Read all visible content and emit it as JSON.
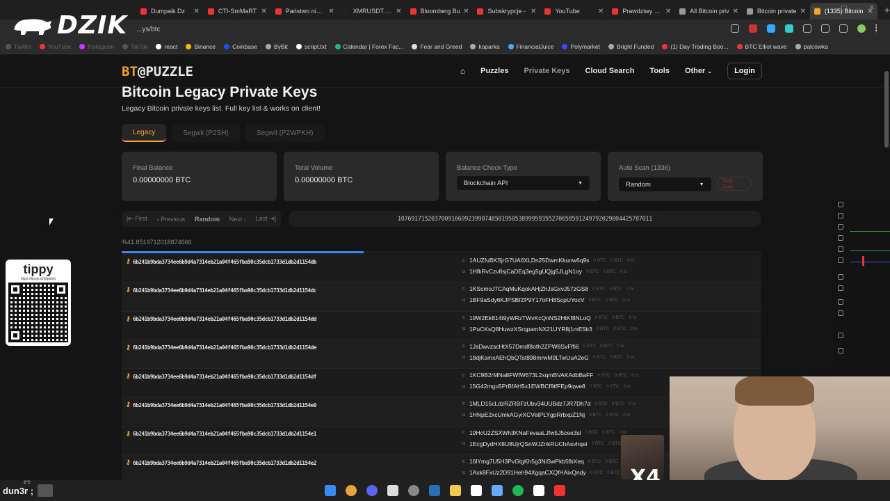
{
  "overlay": {
    "brand": "DZIK"
  },
  "browser": {
    "tabs": [
      {
        "label": "Dumpaik Dz",
        "color": "#e33"
      },
      {
        "label": "CTI-SmMaRT",
        "color": "#e33"
      },
      {
        "label": "Państwo nieuz",
        "color": "#e33"
      },
      {
        "label": "XMRUSDT.P 4",
        "color": "#222"
      },
      {
        "label": "Bloomberg Bu",
        "color": "#e33"
      },
      {
        "label": "Subskrypcje -",
        "color": "#e33"
      },
      {
        "label": "YouTube",
        "color": "#e33"
      },
      {
        "label": "Prawdziwy Lon",
        "color": "#e33"
      },
      {
        "label": "All Bitcoin priv",
        "color": "#999"
      },
      {
        "label": "Bitcoin private",
        "color": "#999"
      },
      {
        "label": "(1335) Bitcoin",
        "color": "#f6a623"
      }
    ],
    "url": "...ys/btc",
    "bookmarks": [
      {
        "label": "Twitter",
        "color": "#555",
        "dim": true
      },
      {
        "label": "YouTube",
        "color": "#e33",
        "dim": true
      },
      {
        "label": "Instagram",
        "color": "#c3f",
        "dim": true
      },
      {
        "label": "TikTok",
        "color": "#555",
        "dim": true
      },
      {
        "label": "react",
        "color": "#fff",
        "dim": false
      },
      {
        "label": "Binance",
        "color": "#f0b90b",
        "dim": false
      },
      {
        "label": "Coinbase",
        "color": "#1652f0",
        "dim": false
      },
      {
        "label": "ByBit",
        "color": "#aaa",
        "dim": false
      },
      {
        "label": "script.txt",
        "color": "#fff",
        "dim": false
      },
      {
        "label": "Calendar | Forex Fac...",
        "color": "#2b7",
        "dim": false
      },
      {
        "label": "Fear and Greed",
        "color": "#ddd",
        "dim": false
      },
      {
        "label": "koparka",
        "color": "#aaa",
        "dim": false
      },
      {
        "label": "FinancialJuice",
        "color": "#4af",
        "dim": false
      },
      {
        "label": "Polymarket",
        "color": "#44f",
        "dim": false
      },
      {
        "label": "Bright Funded",
        "color": "#aaa",
        "dim": false
      },
      {
        "label": "(1) Day Trading Boo...",
        "color": "#e33",
        "dim": false
      },
      {
        "label": "BTC Elliot wave",
        "color": "#e33",
        "dim": false
      },
      {
        "label": "palcówka",
        "color": "#aaa",
        "dim": false
      }
    ]
  },
  "site": {
    "logo_left": "BT",
    "logo_right": "@PUZZLE",
    "nav": {
      "puzzles": "Puzzles",
      "private_keys": "Private Keys",
      "cloud_search": "Cloud Search",
      "tools": "Tools",
      "other": "Other",
      "login": "Login"
    },
    "title": "Bitcoin Legacy Private Keys",
    "subtitle": "Legacy Bitcoin private keys list. Full key list & works on client!",
    "key_tabs": [
      "Legacy",
      "Segwit (P2SH)",
      "Segwit (P2WPKH)"
    ],
    "cards": {
      "final_balance_label": "Final Balance",
      "final_balance_value": "0.00000000 BTC",
      "total_volume_label": "Total Volume",
      "total_volume_value": "0.00000000 BTC",
      "balance_check_label": "Balance Check Type",
      "balance_check_value": "Blockchain API",
      "auto_scan_label": "Auto Scan (1336)",
      "auto_scan_value": "Random",
      "stop_scan": "Stop Scan"
    },
    "pager": {
      "first": "First",
      "previous": "Previous",
      "random": "Random",
      "next": "Next",
      "last": "Last"
    },
    "page_number": "1076917152037009166092399074850195053899959355270658591249792029004425787011",
    "percent": "%41.8519712018874666",
    "progress_fraction": 0.3786,
    "rows": [
      {
        "hex": "6b241b9bda3734ee6b9d4a7314eb21a04f465fba90c35dcb1733d1db2d1154db",
        "c": "1AUZfuBKSjrG7UA6XLDn25DwmKkuow6q9s",
        "u": "1HfkRvCzv8sjCaDEq3eg5gUQjg5JLgN1oy"
      },
      {
        "hex": "6b241b9bda3734ee6b9d4a7314eb21a04f465fba90c35dcb1733d1db2d1154dc",
        "c": "1KScmoJ7CAqMuKqokAHjZhJsGxvJ57zGS8",
        "u": "1BF9aSdy6KJPSBfZP9Y17oFH8ScpUYocV"
      },
      {
        "hex": "6b241b9bda3734ee6b9d4a7314eb21a04f465fba90c35dcb1733d1db2d1154dd",
        "c": "19W2Ek814t9yWRzTWvKcQnNS2HtKf8NLoQ",
        "u": "1PuCKsQ8HuwzXSrqpamNX21UYR8j1mE5b3"
      },
      {
        "hex": "6b241b9bda3734ee6b9d4a7314eb21a04f465fba90c35dcb1733d1db2d1154de",
        "c": "1JsDwvzscHtX57Dmdf8oth2ZPW8SvFffi6",
        "u": "18djKsmxAEhQbQTst898mrwM9LTwUuA2eG"
      },
      {
        "hex": "6b241b9bda3734ee6b9d4a7314eb21a04f465fba90c35dcb1733d1db2d1154df",
        "c": "1KC9B2rMNa8FWfW673L2xqmBVAKAdbBaFF",
        "u": "15G42mgu5PrBfAH5x1EWBCf9tfFEp9qwe8"
      },
      {
        "hex": "6b241b9bda3734ee6b9d4a7314eb21a04f465fba90c35dcb1733d1db2d1154e0",
        "c": "1MLD15cLdzRZRBFzUbv34UUBdz7JR7Dh7d",
        "u": "1HNpE2xcUmkAGyiXCVetPLYgpRrbxpZ1Nj"
      },
      {
        "hex": "6b241b9bda3734ee6b9d4a7314eb21a04f465fba90c35dcb1733d1db2d1154e1",
        "c": "19HcU2ZSXWh3KNaFevaaLJfw5J5cee3sl",
        "u": "1EcgDydHX8U8UjrQSnWJZnkRUChAsvhqei"
      },
      {
        "hex": "6b241b9bda3734ee6b9d4a7314eb21a04f465fba90c35dcb1733d1db2d1154e2",
        "c": "16lYmg7U5H3PvGtgKh5g3NiSwPkb5fbXeq",
        "u": "1Axk8FxUz2D91Heh94XgqaCXQfHAixQndy"
      }
    ],
    "chips": "0 BTC"
  },
  "tippy": {
    "logo": "tippy",
    "url": "https://tipply.pl/@patiro"
  },
  "taskbar": {
    "weather": "dun3r ;",
    "temp": "2°C"
  },
  "webcam": {
    "overlay_text": "X4"
  }
}
